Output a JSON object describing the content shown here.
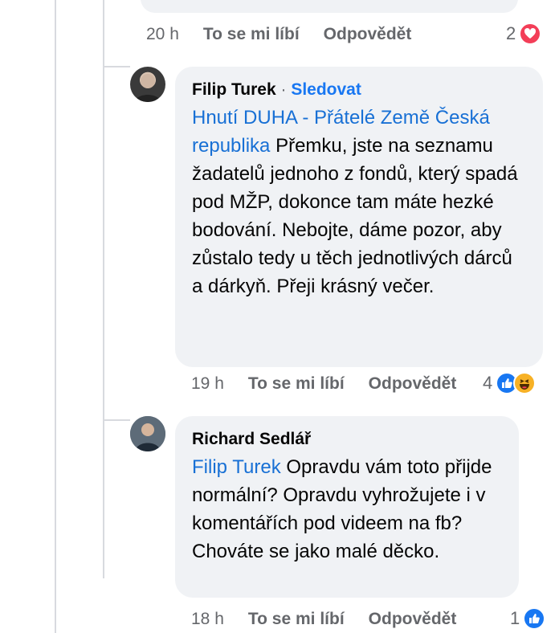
{
  "comments": [
    {
      "time": "20 h",
      "like_label": "To se mi líbí",
      "reply_label": "Odpovědět",
      "reaction_count": "2",
      "reactions": [
        "love-icon"
      ]
    },
    {
      "author": "Filip Turek",
      "separator": "·",
      "follow_label": "Sledovat",
      "mention": "Hnutí DUHA - Přátelé Země Česká republika",
      "text": "Přemku, jste na seznamu žadatelů jednoho z fondů, který spadá pod MŽP, dokonce tam máte hezké bodování. Nebojte, dáme pozor, aby zůstalo tedy u těch jednotlivých dárců a dárkyň. Přeji krásný večer.",
      "time": "19 h",
      "like_label": "To se mi líbí",
      "reply_label": "Odpovědět",
      "reaction_count": "4",
      "reactions": [
        "like-icon",
        "haha-icon"
      ]
    },
    {
      "author": "Richard Sedlář",
      "mention": "Filip Turek",
      "text": "Opravdu vám toto přijde normální? Opravdu vyhrožujete i v komentářích pod videem na fb? Chováte se jako malé děcko.",
      "time": "18 h",
      "like_label": "To se mi líbí",
      "reply_label": "Odpovědět",
      "reaction_count": "1",
      "reactions": [
        "like-icon"
      ]
    }
  ],
  "colors": {
    "bubble": "#f0f2f5",
    "link": "#1870d5",
    "meta": "#65676b",
    "like": "#1877f2",
    "love": "#f33e58",
    "haha": "#f7b125"
  }
}
